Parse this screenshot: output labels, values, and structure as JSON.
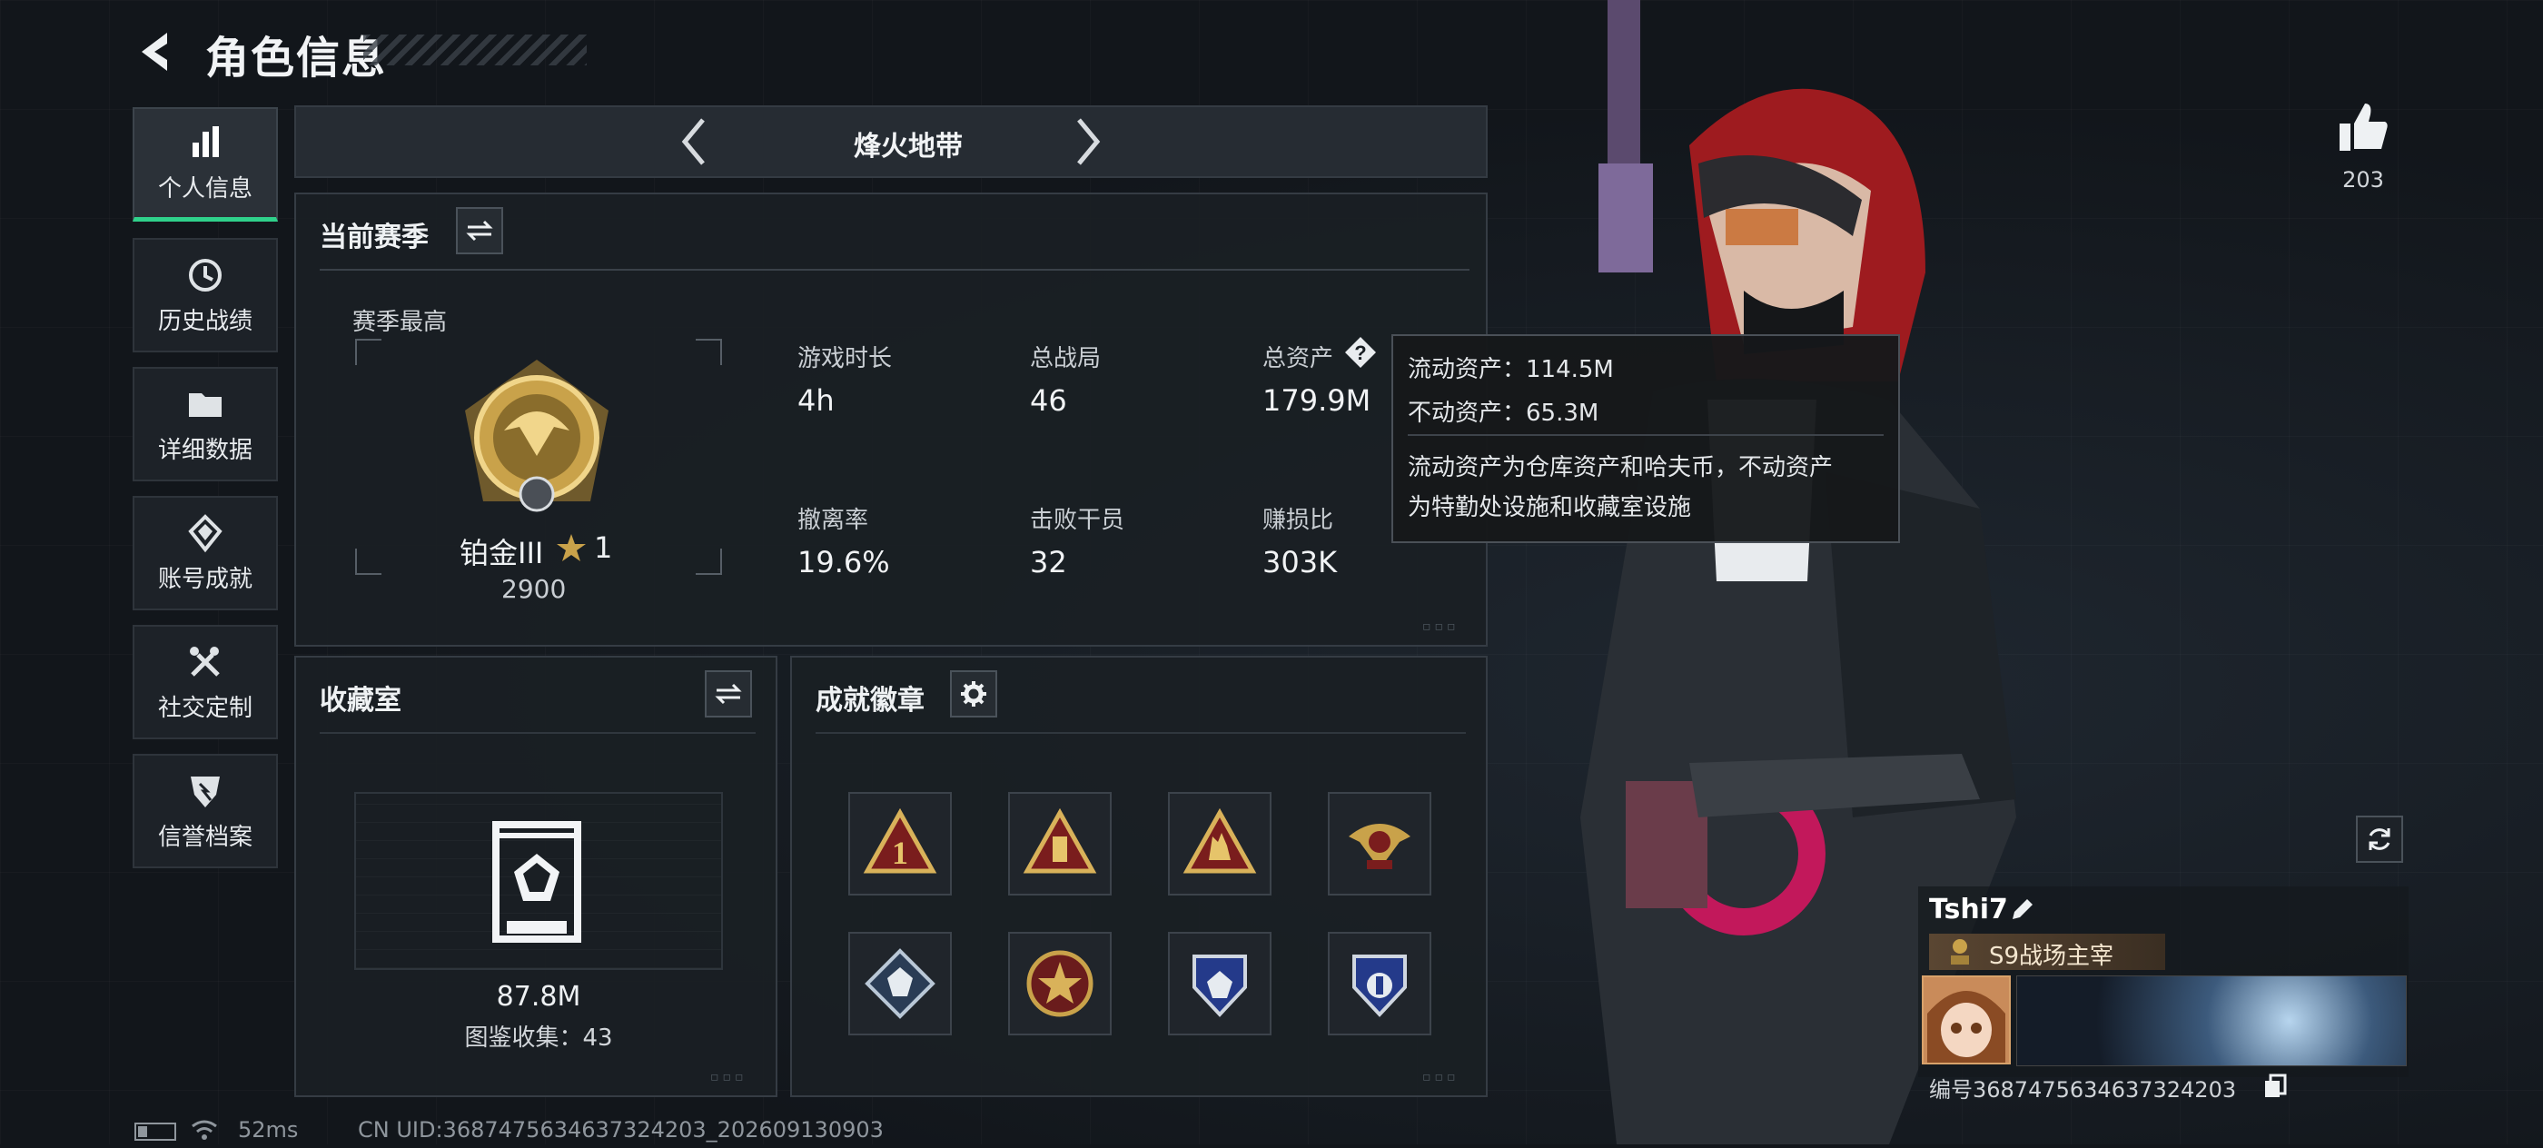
{
  "header": {
    "title": "角色信息",
    "back_icon": "back-arrow-icon"
  },
  "sidebar": {
    "items": [
      {
        "label": "个人信息",
        "icon": "bar-chart-icon",
        "active": true
      },
      {
        "label": "历史战绩",
        "icon": "history-icon",
        "active": false
      },
      {
        "label": "详细数据",
        "icon": "folder-icon",
        "active": false
      },
      {
        "label": "账号成就",
        "icon": "achievement-icon",
        "active": false
      },
      {
        "label": "社交定制",
        "icon": "tools-icon",
        "active": false
      },
      {
        "label": "信誉档案",
        "icon": "shield-icon",
        "active": false
      }
    ]
  },
  "mode": {
    "name": "烽火地带"
  },
  "season": {
    "title": "当前赛季",
    "best_label": "赛季最高",
    "rank_name": "铂金III",
    "rank_stars": "1",
    "rank_score": "2900",
    "stats": [
      {
        "label": "游戏时长",
        "value": "4h"
      },
      {
        "label": "总战局",
        "value": "46"
      },
      {
        "label": "总资产",
        "value": "179.9M"
      },
      {
        "label": "撤离率",
        "value": "19.6%"
      },
      {
        "label": "击败干员",
        "value": "32"
      },
      {
        "label": "赚损比",
        "value": "303K"
      }
    ]
  },
  "tooltip": {
    "liquid": "流动资产：114.5M",
    "fixed": "不动资产：65.3M",
    "desc_line1": "流动资产为仓库资产和哈夫币，不动资产",
    "desc_line2": "为特勤处设施和收藏室设施"
  },
  "collection": {
    "title": "收藏室",
    "value": "87.8M",
    "catalog": "图鉴收集：43"
  },
  "badges": {
    "title": "成就徽章",
    "items": [
      "badge-1",
      "badge-2",
      "badge-3",
      "badge-4",
      "badge-5",
      "badge-6",
      "badge-7",
      "badge-8"
    ]
  },
  "likes": {
    "count": "203"
  },
  "profile": {
    "name": "Tshi7",
    "title": "S9战场主宰",
    "uid": "编号3687475634637324203"
  },
  "footer": {
    "ping": "52ms",
    "uid": "CN UID:3687475634637324203_202609130903"
  },
  "colors": {
    "accent_green": "#2fd18b",
    "gold": "#c9a24a",
    "bg": "#12161b"
  }
}
